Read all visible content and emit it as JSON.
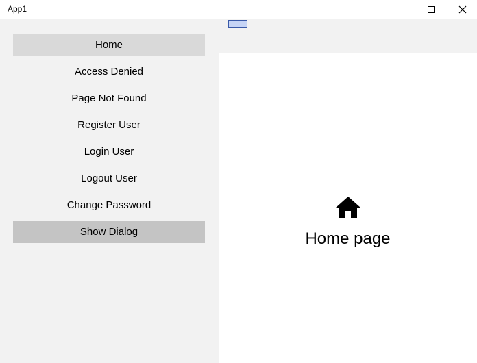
{
  "window": {
    "title": "App1"
  },
  "caption_buttons": {
    "minimize_icon": "minimize-icon",
    "maximize_icon": "maximize-icon",
    "close_icon": "close-icon"
  },
  "sidebar": {
    "items": [
      {
        "label": "Home",
        "state": "selected"
      },
      {
        "label": "Access Denied",
        "state": "normal"
      },
      {
        "label": "Page Not Found",
        "state": "normal"
      },
      {
        "label": "Register User",
        "state": "normal"
      },
      {
        "label": "Login User",
        "state": "normal"
      },
      {
        "label": "Logout User",
        "state": "normal"
      },
      {
        "label": "Change Password",
        "state": "normal"
      },
      {
        "label": "Show Dialog",
        "state": "hovered"
      }
    ]
  },
  "main": {
    "icon": "home-icon",
    "heading": "Home page"
  },
  "colors": {
    "sidebar_bg": "#f2f2f2",
    "selected_bg": "#d9d9d9",
    "hover_bg": "#c4c4c4",
    "content_bg": "#ffffff",
    "handle_border": "#3a5aa8",
    "handle_fill": "#c6d4f5"
  }
}
